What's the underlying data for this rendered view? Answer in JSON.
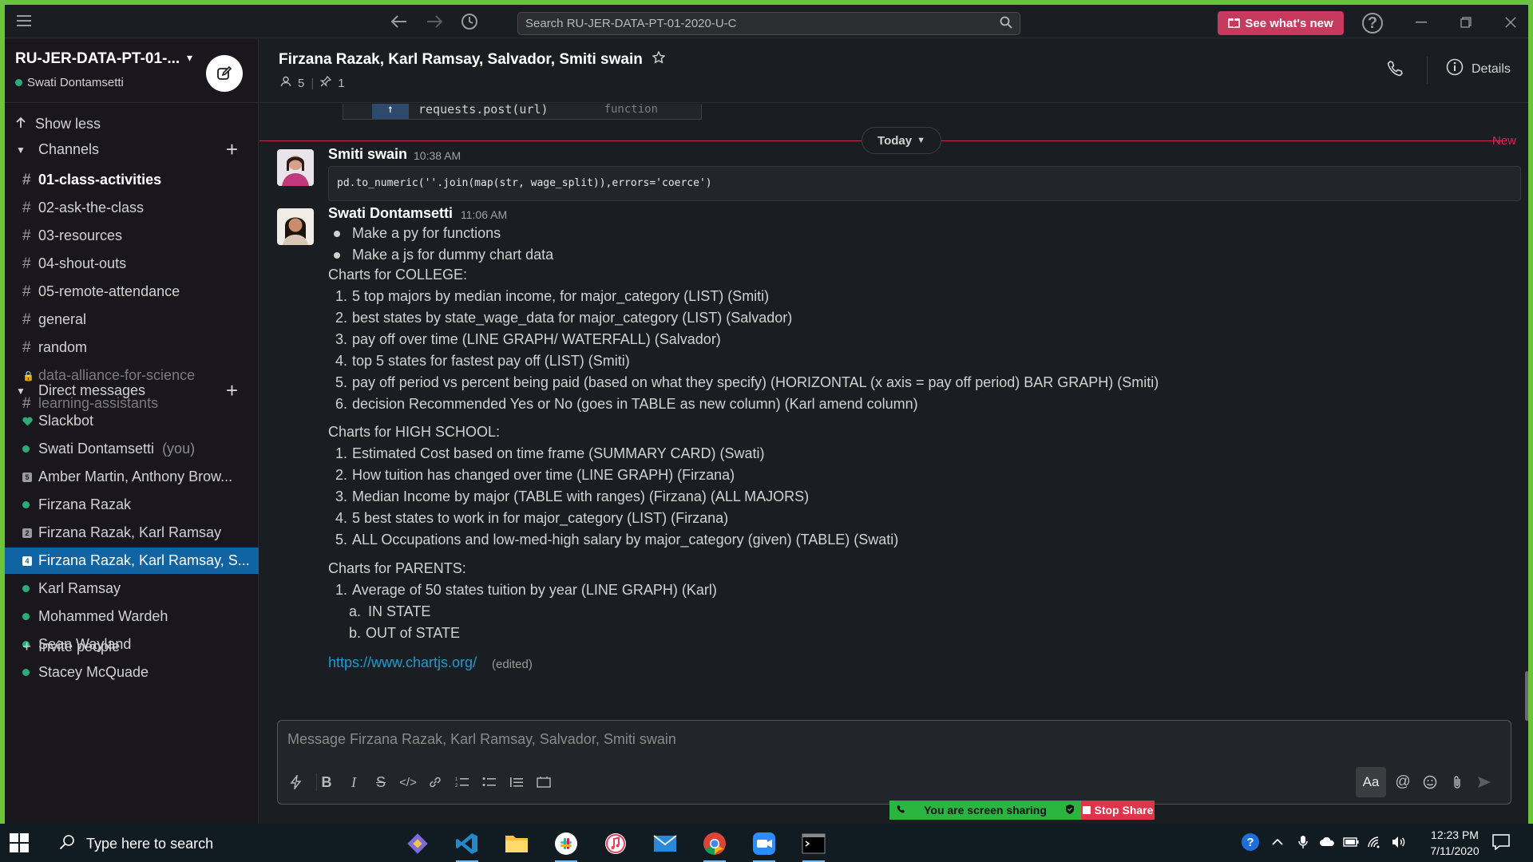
{
  "topbar": {
    "search_placeholder": "Search RU-JER-DATA-PT-01-2020-U-C",
    "whats_new": "See what's new"
  },
  "sidebar": {
    "workspace": "RU-JER-DATA-PT-01-...",
    "user": "Swati Dontamsetti",
    "show_less": "Show less",
    "channels_label": "Channels",
    "channels": [
      {
        "name": "01-class-activities",
        "style": "bold"
      },
      {
        "name": "02-ask-the-class",
        "style": "normal"
      },
      {
        "name": "03-resources",
        "style": "normal"
      },
      {
        "name": "04-shout-outs",
        "style": "normal"
      },
      {
        "name": "05-remote-attendance",
        "style": "normal"
      },
      {
        "name": "general",
        "style": "normal"
      },
      {
        "name": "random",
        "style": "normal"
      },
      {
        "name": "data-alliance-for-science",
        "style": "muted"
      },
      {
        "name": "learning-assistants",
        "style": "muted"
      }
    ],
    "dm_label": "Direct messages",
    "dms": [
      {
        "name": "Slackbot"
      },
      {
        "name": "Swati Dontamsetti",
        "suffix": "(you)"
      },
      {
        "name": "Amber Martin, Anthony Brow...",
        "count": "5"
      },
      {
        "name": "Firzana Razak"
      },
      {
        "name": "Firzana Razak, Karl Ramsay",
        "count": "2"
      },
      {
        "name": "Firzana Razak, Karl Ramsay, S...",
        "count": "4",
        "active": true
      },
      {
        "name": "Karl Ramsay"
      },
      {
        "name": "Mohammed Wardeh"
      },
      {
        "name": "Sean Wayland"
      },
      {
        "name": "Stacey McQuade"
      }
    ],
    "invite": "Invite people"
  },
  "channel": {
    "title": "Firzana Razak, Karl Ramsay, Salvador, Smiti swain",
    "members": "5",
    "pins": "1",
    "details": "Details"
  },
  "messages": {
    "snippet_code": "requests.post(url)",
    "snippet_kind": "function",
    "today": "Today",
    "new_label": "New",
    "msg1": {
      "sender": "Smiti swain",
      "time": "10:38 AM",
      "code": "pd.to_numeric(''.join(map(str, wage_split)),errors='coerce')"
    },
    "msg2": {
      "sender": "Swati Dontamsetti",
      "time": "11:06 AM",
      "bullets": [
        "Make a py for functions",
        "Make a js for dummy chart data"
      ],
      "college_head": "Charts for COLLEGE:",
      "college": [
        "5 top majors by median income, for major_category (LIST) (Smiti)",
        "best states by state_wage_data for major_category (LIST) (Salvador)",
        "pay off over time (LINE GRAPH/ WATERFALL) (Salvador)",
        "top 5 states for fastest pay off (LIST) (Smiti)",
        "pay off period vs percent being paid (based on what they specify) (HORIZONTAL (x axis = pay off period) BAR GRAPH) (Smiti)",
        "decision Recommended Yes or No (goes in TABLE as new column) (Karl amend column)"
      ],
      "hs_head": "Charts for HIGH SCHOOL:",
      "hs": [
        "Estimated Cost based on time frame (SUMMARY CARD) (Swati)",
        "How tuition has changed over time (LINE GRAPH) (Firzana)",
        "Median Income by major (TABLE with ranges) (Firzana) (ALL MAJORS)",
        "5 best states to work in for major_category (LIST) (Firzana)",
        "ALL Occupations and low-med-high salary by major_category (given) (TABLE) (Swati)"
      ],
      "parents_head": "Charts for PARENTS:",
      "parents_item": "Average of 50 states tuition by year (LINE GRAPH) (Karl)",
      "parents_sub_a": "IN STATE",
      "parents_sub_b": "OUT of STATE",
      "link": "https://www.chartjs.org/",
      "edited": "(edited)"
    }
  },
  "composer": {
    "placeholder": "Message Firzana Razak, Karl Ramsay, Salvador, Smiti swain",
    "aa": "Aa"
  },
  "screenshare": {
    "status": "You are screen sharing",
    "stop": "Stop Share"
  },
  "taskbar": {
    "search": "Type here to search",
    "time": "12:23 PM",
    "date": "7/11/2020"
  },
  "colors": {
    "accent_active": "#1164a3",
    "presence": "#2bac76",
    "new_line": "#e01e5a",
    "link": "#1d9bd1",
    "whats_new_bg": "#c73a5d"
  }
}
